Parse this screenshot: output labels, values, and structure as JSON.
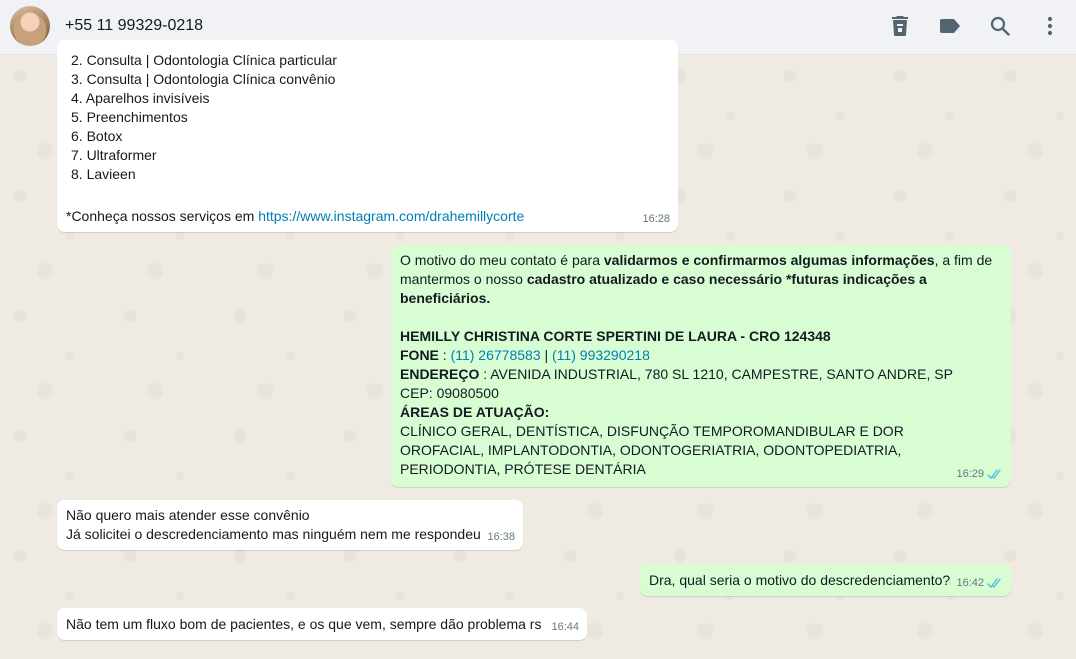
{
  "header": {
    "contact_name": "+55 11 99329-0218",
    "icons": [
      "delete-icon",
      "label-icon",
      "search-icon",
      "more-icon"
    ]
  },
  "messages": {
    "m1": {
      "list_items": [
        "2.  Consulta | Odontologia Clínica particular",
        "3.  Consulta | Odontologia Clínica convênio",
        "4.  Aparelhos invisíveis",
        "5.  Preenchimentos",
        "6.  Botox",
        "7.  Ultraformer",
        "8.  Lavieen"
      ],
      "footer_text": "*Conheça nossos serviços em ",
      "footer_link": "https://www.instagram.com/drahemillycorte",
      "time": "16:28"
    },
    "m2": {
      "p1_a": "O motivo do meu contato é para ",
      "p1_b": "validarmos e confirmarmos algumas informações",
      "p1_c": ", a fim de mantermos o nosso ",
      "p1_d": "cadastro atualizado e caso necessário *futuras indicações a beneficiários.",
      "name_line": "HEMILLY CHRISTINA CORTE SPERTINI DE LAURA - CRO 124348",
      "fone_label": "FONE",
      "fone_sep": " : ",
      "phone1": "(11) 26778583",
      "phone_sep": " | ",
      "phone2": "(11) 993290218",
      "endereco_label": "ENDEREÇO",
      "endereco_value": " : AVENIDA INDUSTRIAL, 780 SL 1210, CAMPESTRE, SANTO ANDRE, SP CEP: 09080500",
      "areas_label": "ÁREAS DE ATUAÇÃO:",
      "areas_value": "CLÍNICO GERAL, DENTÍSTICA, DISFUNÇÃO TEMPOROMANDIBULAR E DOR OROFACIAL, IMPLANTODONTIA, ODONTOGERIATRIA, ODONTOPEDIATRIA, PERIODONTIA, PRÓTESE DENTÁRIA",
      "time": "16:29"
    },
    "m3": {
      "line1": "Não quero mais atender esse convênio",
      "line2": "Já solicitei o descredenciamento mas ninguém nem me respondeu",
      "time": "16:38"
    },
    "m4": {
      "text": "Dra, qual seria o motivo do descredenciamento?",
      "time": "16:42"
    },
    "m5": {
      "text": "Não tem um fluxo bom de pacientes, e os que vem, sempre dão problema rs",
      "time": "16:44"
    }
  },
  "colors": {
    "incoming_bg": "#ffffff",
    "outgoing_bg": "#d9fdd3",
    "link": "#027eb5",
    "read_ticks": "#53bdeb"
  }
}
